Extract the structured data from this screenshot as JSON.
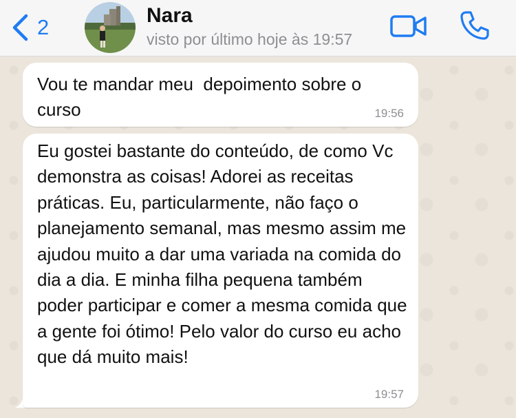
{
  "header": {
    "back_count": "2",
    "contact_name": "Nara",
    "last_seen": "visto por último hoje às 19:57",
    "icons": {
      "back": "chevron-left-icon",
      "video": "video-camera-icon",
      "call": "phone-icon"
    },
    "accent_color": "#1f7cf2"
  },
  "messages": [
    {
      "text": "Vou te mandar meu  depoimento sobre o curso",
      "time": "19:56"
    },
    {
      "text": "Eu gostei bastante do conteúdo, de como Vc demonstra as coisas! Adorei as receitas práticas. Eu, particularmente, não faço o planejamento semanal, mas mesmo assim me ajudou muito a dar uma variada na comida do dia a dia. E minha filha pequena também poder participar e comer a mesma comida que a gente foi ótimo! Pelo valor do curso eu acho que dá muito mais!",
      "time": "19:57"
    }
  ]
}
